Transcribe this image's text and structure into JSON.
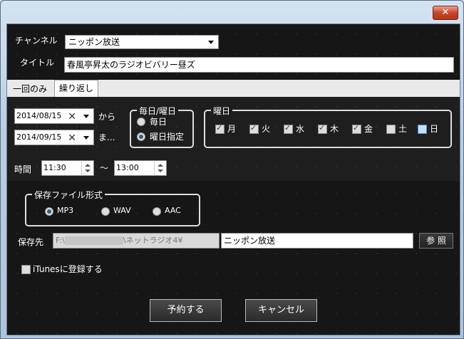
{
  "window": {
    "close_glyph": "✕"
  },
  "channel": {
    "label": "チャンネル",
    "value": "ニッポン放送"
  },
  "title": {
    "label": "タイトル",
    "value": "春風亭昇太のラジオビバリー昼ズ"
  },
  "tabs": [
    {
      "label": "一回のみ",
      "active": false
    },
    {
      "label": "繰り返し",
      "active": true
    }
  ],
  "schedule": {
    "start_date": "2014/08/15",
    "from_label": "から",
    "end_date": "2014/09/15",
    "to_label": "ま...",
    "clear_glyph": "✕"
  },
  "repeat_group": {
    "title": "毎日/曜日",
    "options": [
      {
        "label": "毎日",
        "selected": false
      },
      {
        "label": "曜日指定",
        "selected": true
      }
    ]
  },
  "weekday_group": {
    "title": "曜日",
    "days": [
      {
        "label": "月",
        "checked": true
      },
      {
        "label": "火",
        "checked": true
      },
      {
        "label": "水",
        "checked": true
      },
      {
        "label": "木",
        "checked": true
      },
      {
        "label": "金",
        "checked": true
      },
      {
        "label": "土",
        "checked": false
      },
      {
        "label": "日",
        "checked": false
      }
    ]
  },
  "time": {
    "label": "時間",
    "start": "11:30",
    "separator": "～",
    "end": "13:00"
  },
  "format_group": {
    "title": "保存ファイル形式",
    "options": [
      {
        "label": "MP3",
        "selected": true
      },
      {
        "label": "WAV",
        "selected": false
      },
      {
        "label": "AAC",
        "selected": false
      }
    ]
  },
  "save": {
    "label": "保存先",
    "path_prefix": "F:\\",
    "path_suffix": "\\ネットラジオ4¥",
    "folder_value": "ニッポン放送",
    "browse_label": "参 照"
  },
  "itunes": {
    "label": "iTunesに登録する",
    "checked": false
  },
  "buttons": {
    "reserve": "予約する",
    "cancel": "キャンセル"
  },
  "colors": {
    "accent": "#3a5a8a",
    "window_frame": "#b9cde2",
    "close": "#c8452d",
    "background": "#161616"
  }
}
